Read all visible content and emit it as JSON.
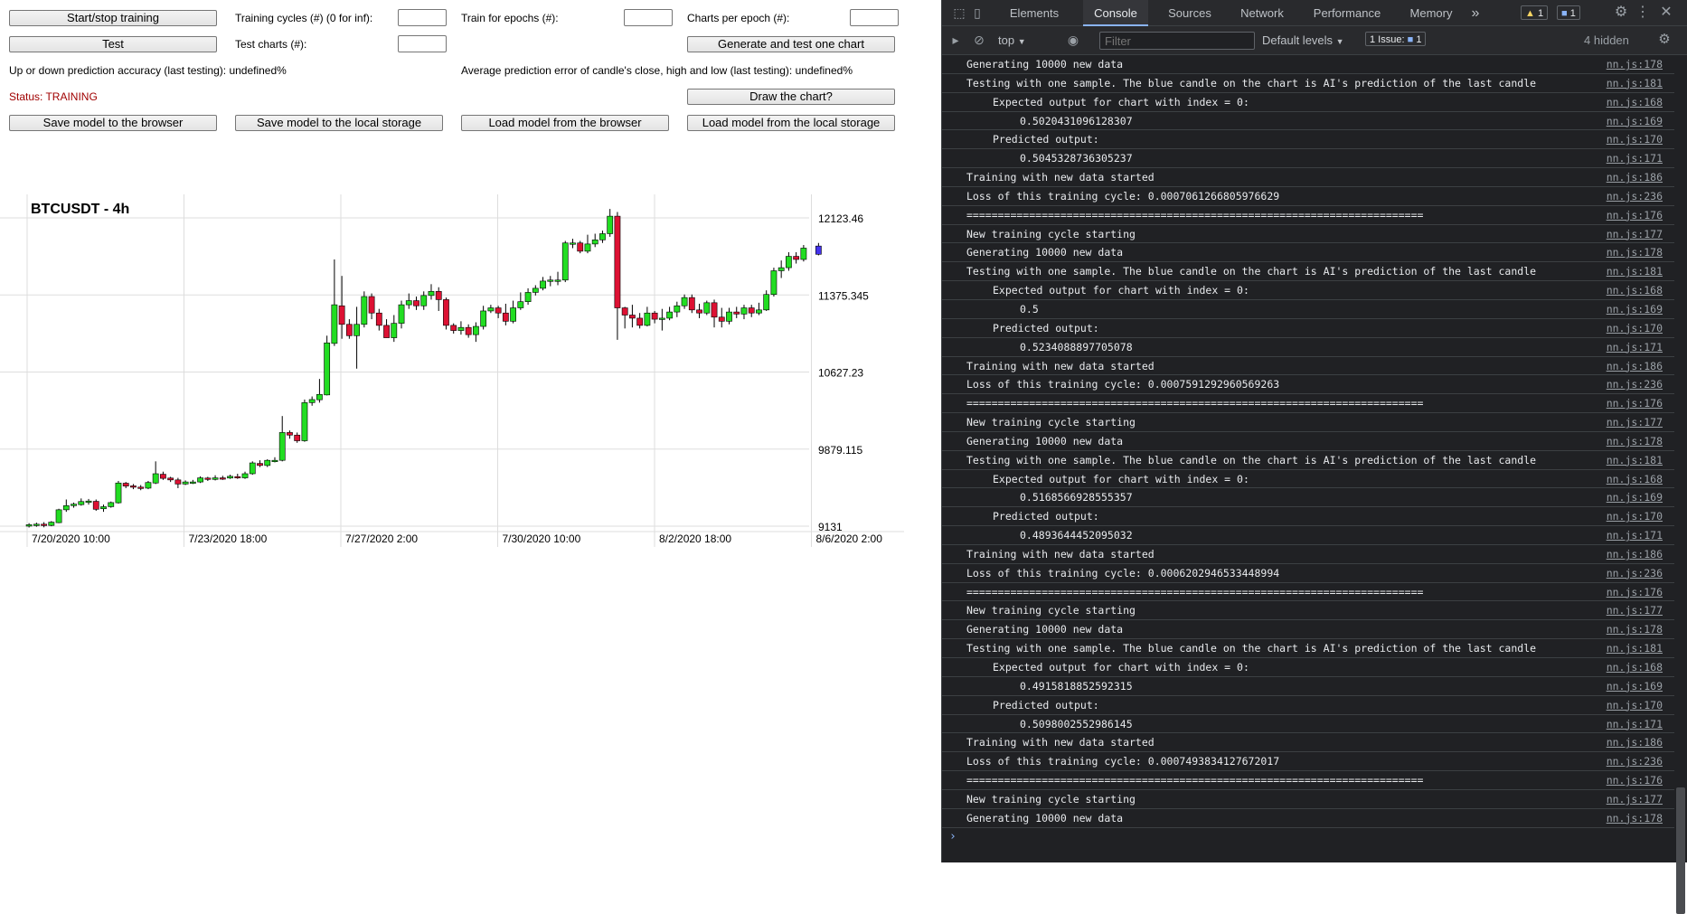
{
  "controls": {
    "start_stop": "Start/stop training",
    "training_cycles_label": "Training cycles (#) (0 for inf):",
    "train_epochs_label": "Train for epochs (#):",
    "charts_per_epoch_label": "Charts per epoch (#):",
    "test": "Test",
    "test_charts_label": "Test charts (#):",
    "generate_test": "Generate and test one chart",
    "accuracy": "Up or down prediction accuracy (last testing): undefined%",
    "avg_error": "Average prediction error of candle's close, high and low (last testing): undefined%",
    "status": "Status: TRAINING",
    "draw_chart": "Draw the chart?",
    "save_browser": "Save model to the browser",
    "save_local": "Save model to the local storage",
    "load_browser": "Load model from the browser",
    "load_local": "Load model from the local storage"
  },
  "chart_data": {
    "type": "candlestick",
    "title": "BTCUSDT - 4h",
    "y_ticks": [
      "12123.46",
      "11375.345",
      "10627.23",
      "9879.115",
      "9131"
    ],
    "x_ticks": [
      "7/20/2020 10:00",
      "7/23/2020 18:00",
      "7/27/2020 2:00",
      "7/30/2020 10:00",
      "8/2/2020 18:00",
      "8/6/2020 2:00"
    ],
    "ylim": [
      9131,
      12123.46
    ],
    "colors": {
      "up": "#22dd22",
      "down": "#dd1133",
      "predicted": "#4433ee"
    },
    "candles": [
      [
        9131,
        9145,
        9118,
        9160
      ],
      [
        9140,
        9150,
        9125,
        9165
      ],
      [
        9150,
        9138,
        9120,
        9170
      ],
      [
        9138,
        9170,
        9130,
        9180
      ],
      [
        9165,
        9290,
        9160,
        9300
      ],
      [
        9290,
        9330,
        9270,
        9390
      ],
      [
        9330,
        9345,
        9310,
        9360
      ],
      [
        9340,
        9370,
        9330,
        9400
      ],
      [
        9370,
        9375,
        9340,
        9395
      ],
      [
        9372,
        9295,
        9280,
        9390
      ],
      [
        9300,
        9320,
        9270,
        9340
      ],
      [
        9320,
        9360,
        9310,
        9370
      ],
      [
        9358,
        9550,
        9350,
        9570
      ],
      [
        9548,
        9520,
        9500,
        9560
      ],
      [
        9522,
        9510,
        9490,
        9540
      ],
      [
        9510,
        9500,
        9480,
        9530
      ],
      [
        9500,
        9555,
        9490,
        9570
      ],
      [
        9550,
        9640,
        9540,
        9760
      ],
      [
        9635,
        9595,
        9580,
        9660
      ],
      [
        9598,
        9580,
        9560,
        9610
      ],
      [
        9580,
        9540,
        9500,
        9600
      ],
      [
        9540,
        9560,
        9530,
        9575
      ],
      [
        9560,
        9560,
        9540,
        9580
      ],
      [
        9560,
        9600,
        9550,
        9615
      ],
      [
        9598,
        9585,
        9570,
        9610
      ],
      [
        9585,
        9600,
        9575,
        9625
      ],
      [
        9600,
        9595,
        9580,
        9620
      ],
      [
        9598,
        9615,
        9590,
        9630
      ],
      [
        9612,
        9600,
        9590,
        9640
      ],
      [
        9600,
        9640,
        9590,
        9660
      ],
      [
        9640,
        9745,
        9630,
        9760
      ],
      [
        9740,
        9720,
        9705,
        9770
      ],
      [
        9720,
        9770,
        9705,
        9780
      ],
      [
        9770,
        9770,
        9750,
        9800
      ],
      [
        9770,
        10040,
        9760,
        10200
      ],
      [
        10040,
        10015,
        9980,
        10060
      ],
      [
        10015,
        9960,
        9940,
        10040
      ],
      [
        9960,
        10330,
        9950,
        10360
      ],
      [
        10330,
        10360,
        10300,
        10390
      ],
      [
        10358,
        10410,
        10330,
        10560
      ],
      [
        10405,
        10910,
        10400,
        10980
      ],
      [
        10905,
        11280,
        10880,
        11720
      ],
      [
        11270,
        11090,
        10950,
        11560
      ],
      [
        11090,
        10980,
        10950,
        11140
      ],
      [
        10980,
        11090,
        10660,
        11260
      ],
      [
        11090,
        11360,
        11060,
        11410
      ],
      [
        11360,
        11200,
        11140,
        11390
      ],
      [
        11200,
        11080,
        11030,
        11240
      ],
      [
        11080,
        10960,
        10960,
        11140
      ],
      [
        10960,
        11100,
        10920,
        11180
      ],
      [
        11100,
        11280,
        11050,
        11320
      ],
      [
        11280,
        11320,
        11240,
        11390
      ],
      [
        11320,
        11270,
        11230,
        11360
      ],
      [
        11270,
        11370,
        11230,
        11410
      ],
      [
        11370,
        11410,
        11330,
        11480
      ],
      [
        11410,
        11330,
        11220,
        11450
      ],
      [
        11330,
        11080,
        11040,
        11350
      ],
      [
        11080,
        11030,
        11000,
        11100
      ],
      [
        11030,
        11060,
        10990,
        11120
      ],
      [
        11060,
        10990,
        10960,
        11090
      ],
      [
        10990,
        11070,
        10920,
        11110
      ],
      [
        11070,
        11220,
        11040,
        11270
      ],
      [
        11220,
        11250,
        11200,
        11280
      ],
      [
        11250,
        11200,
        11150,
        11270
      ],
      [
        11200,
        11120,
        11080,
        11290
      ],
      [
        11120,
        11250,
        11100,
        11320
      ],
      [
        11250,
        11310,
        11230,
        11400
      ],
      [
        11310,
        11400,
        11280,
        11440
      ],
      [
        11400,
        11440,
        11370,
        11470
      ],
      [
        11440,
        11510,
        11420,
        11550
      ],
      [
        11510,
        11520,
        11460,
        11560
      ],
      [
        11520,
        11520,
        11470,
        11600
      ],
      [
        11520,
        11880,
        11500,
        11900
      ],
      [
        11880,
        11880,
        11830,
        11920
      ],
      [
        11880,
        11800,
        11780,
        11900
      ],
      [
        11800,
        11870,
        11780,
        11960
      ],
      [
        11870,
        11910,
        11840,
        11970
      ],
      [
        11910,
        11970,
        11880,
        12000
      ],
      [
        11970,
        12140,
        11940,
        12210
      ],
      [
        12140,
        11250,
        10940,
        12180
      ],
      [
        11250,
        11180,
        11050,
        11260
      ],
      [
        11180,
        11150,
        11060,
        11280
      ],
      [
        11150,
        11080,
        11050,
        11200
      ],
      [
        11080,
        11200,
        11070,
        11260
      ],
      [
        11200,
        11140,
        11100,
        11220
      ],
      [
        11140,
        11150,
        11030,
        11240
      ],
      [
        11150,
        11210,
        11130,
        11260
      ],
      [
        11210,
        11270,
        11160,
        11310
      ],
      [
        11270,
        11350,
        11240,
        11380
      ],
      [
        11350,
        11230,
        11200,
        11380
      ],
      [
        11230,
        11200,
        11150,
        11290
      ],
      [
        11200,
        11300,
        11180,
        11320
      ],
      [
        11300,
        11160,
        11060,
        11330
      ],
      [
        11160,
        11120,
        11060,
        11250
      ],
      [
        11120,
        11210,
        11090,
        11250
      ],
      [
        11210,
        11190,
        11150,
        11260
      ],
      [
        11190,
        11250,
        11140,
        11280
      ],
      [
        11250,
        11200,
        11160,
        11280
      ],
      [
        11200,
        11230,
        11180,
        11300
      ],
      [
        11230,
        11380,
        11220,
        11420
      ],
      [
        11380,
        11610,
        11360,
        11640
      ],
      [
        11610,
        11640,
        11540,
        11710
      ],
      [
        11640,
        11750,
        11610,
        11790
      ],
      [
        11750,
        11720,
        11680,
        11790
      ],
      [
        11720,
        11830,
        11700,
        11860
      ]
    ],
    "predicted": [
      11770,
      11850,
      11760,
      11880
    ]
  },
  "devtools": {
    "tabs": [
      "Elements",
      "Console",
      "Sources",
      "Network",
      "Performance",
      "Memory"
    ],
    "more": "»",
    "warn_count": "1",
    "msg_count": "1",
    "context": "top",
    "filter_placeholder": "Filter",
    "levels": "Default levels",
    "issues_label": "1 Issue:",
    "issues_count": "1",
    "hidden": "4 hidden",
    "prompt": "›",
    "logs": [
      {
        "i": 0,
        "m": "Generating 10000 new data",
        "s": "nn.js:178"
      },
      {
        "i": 0,
        "m": "Testing with one sample. The blue candle on the chart is AI's prediction of the last candle",
        "s": "nn.js:181"
      },
      {
        "i": 1,
        "m": "Expected output for chart with index = 0:",
        "s": "nn.js:168"
      },
      {
        "i": 2,
        "m": "0.5020431096128307",
        "s": "nn.js:169"
      },
      {
        "i": 1,
        "m": "Predicted output:",
        "s": "nn.js:170"
      },
      {
        "i": 2,
        "m": "0.5045328736305237",
        "s": "nn.js:171"
      },
      {
        "i": 0,
        "m": "Training with new data started",
        "s": "nn.js:186"
      },
      {
        "i": 0,
        "m": "Loss of this training cycle: 0.0007061266805976629",
        "s": "nn.js:236"
      },
      {
        "i": 0,
        "m": "=========================================================================",
        "s": "nn.js:176"
      },
      {
        "i": 0,
        "m": "New training cycle starting",
        "s": "nn.js:177"
      },
      {
        "i": 0,
        "m": "Generating 10000 new data",
        "s": "nn.js:178"
      },
      {
        "i": 0,
        "m": "Testing with one sample. The blue candle on the chart is AI's prediction of the last candle",
        "s": "nn.js:181"
      },
      {
        "i": 1,
        "m": "Expected output for chart with index = 0:",
        "s": "nn.js:168"
      },
      {
        "i": 2,
        "m": "0.5",
        "s": "nn.js:169"
      },
      {
        "i": 1,
        "m": "Predicted output:",
        "s": "nn.js:170"
      },
      {
        "i": 2,
        "m": "0.5234088897705078",
        "s": "nn.js:171"
      },
      {
        "i": 0,
        "m": "Training with new data started",
        "s": "nn.js:186"
      },
      {
        "i": 0,
        "m": "Loss of this training cycle: 0.0007591292960569263",
        "s": "nn.js:236"
      },
      {
        "i": 0,
        "m": "=========================================================================",
        "s": "nn.js:176"
      },
      {
        "i": 0,
        "m": "New training cycle starting",
        "s": "nn.js:177"
      },
      {
        "i": 0,
        "m": "Generating 10000 new data",
        "s": "nn.js:178"
      },
      {
        "i": 0,
        "m": "Testing with one sample. The blue candle on the chart is AI's prediction of the last candle",
        "s": "nn.js:181"
      },
      {
        "i": 1,
        "m": "Expected output for chart with index = 0:",
        "s": "nn.js:168"
      },
      {
        "i": 2,
        "m": "0.5168566928555357",
        "s": "nn.js:169"
      },
      {
        "i": 1,
        "m": "Predicted output:",
        "s": "nn.js:170"
      },
      {
        "i": 2,
        "m": "0.4893644452095032",
        "s": "nn.js:171"
      },
      {
        "i": 0,
        "m": "Training with new data started",
        "s": "nn.js:186"
      },
      {
        "i": 0,
        "m": "Loss of this training cycle: 0.0006202946533448994",
        "s": "nn.js:236"
      },
      {
        "i": 0,
        "m": "=========================================================================",
        "s": "nn.js:176"
      },
      {
        "i": 0,
        "m": "New training cycle starting",
        "s": "nn.js:177"
      },
      {
        "i": 0,
        "m": "Generating 10000 new data",
        "s": "nn.js:178"
      },
      {
        "i": 0,
        "m": "Testing with one sample. The blue candle on the chart is AI's prediction of the last candle",
        "s": "nn.js:181"
      },
      {
        "i": 1,
        "m": "Expected output for chart with index = 0:",
        "s": "nn.js:168"
      },
      {
        "i": 2,
        "m": "0.4915818852592315",
        "s": "nn.js:169"
      },
      {
        "i": 1,
        "m": "Predicted output:",
        "s": "nn.js:170"
      },
      {
        "i": 2,
        "m": "0.5098002552986145",
        "s": "nn.js:171"
      },
      {
        "i": 0,
        "m": "Training with new data started",
        "s": "nn.js:186"
      },
      {
        "i": 0,
        "m": "Loss of this training cycle: 0.0007493834127672017",
        "s": "nn.js:236"
      },
      {
        "i": 0,
        "m": "=========================================================================",
        "s": "nn.js:176"
      },
      {
        "i": 0,
        "m": "New training cycle starting",
        "s": "nn.js:177"
      },
      {
        "i": 0,
        "m": "Generating 10000 new data",
        "s": "nn.js:178"
      }
    ]
  }
}
